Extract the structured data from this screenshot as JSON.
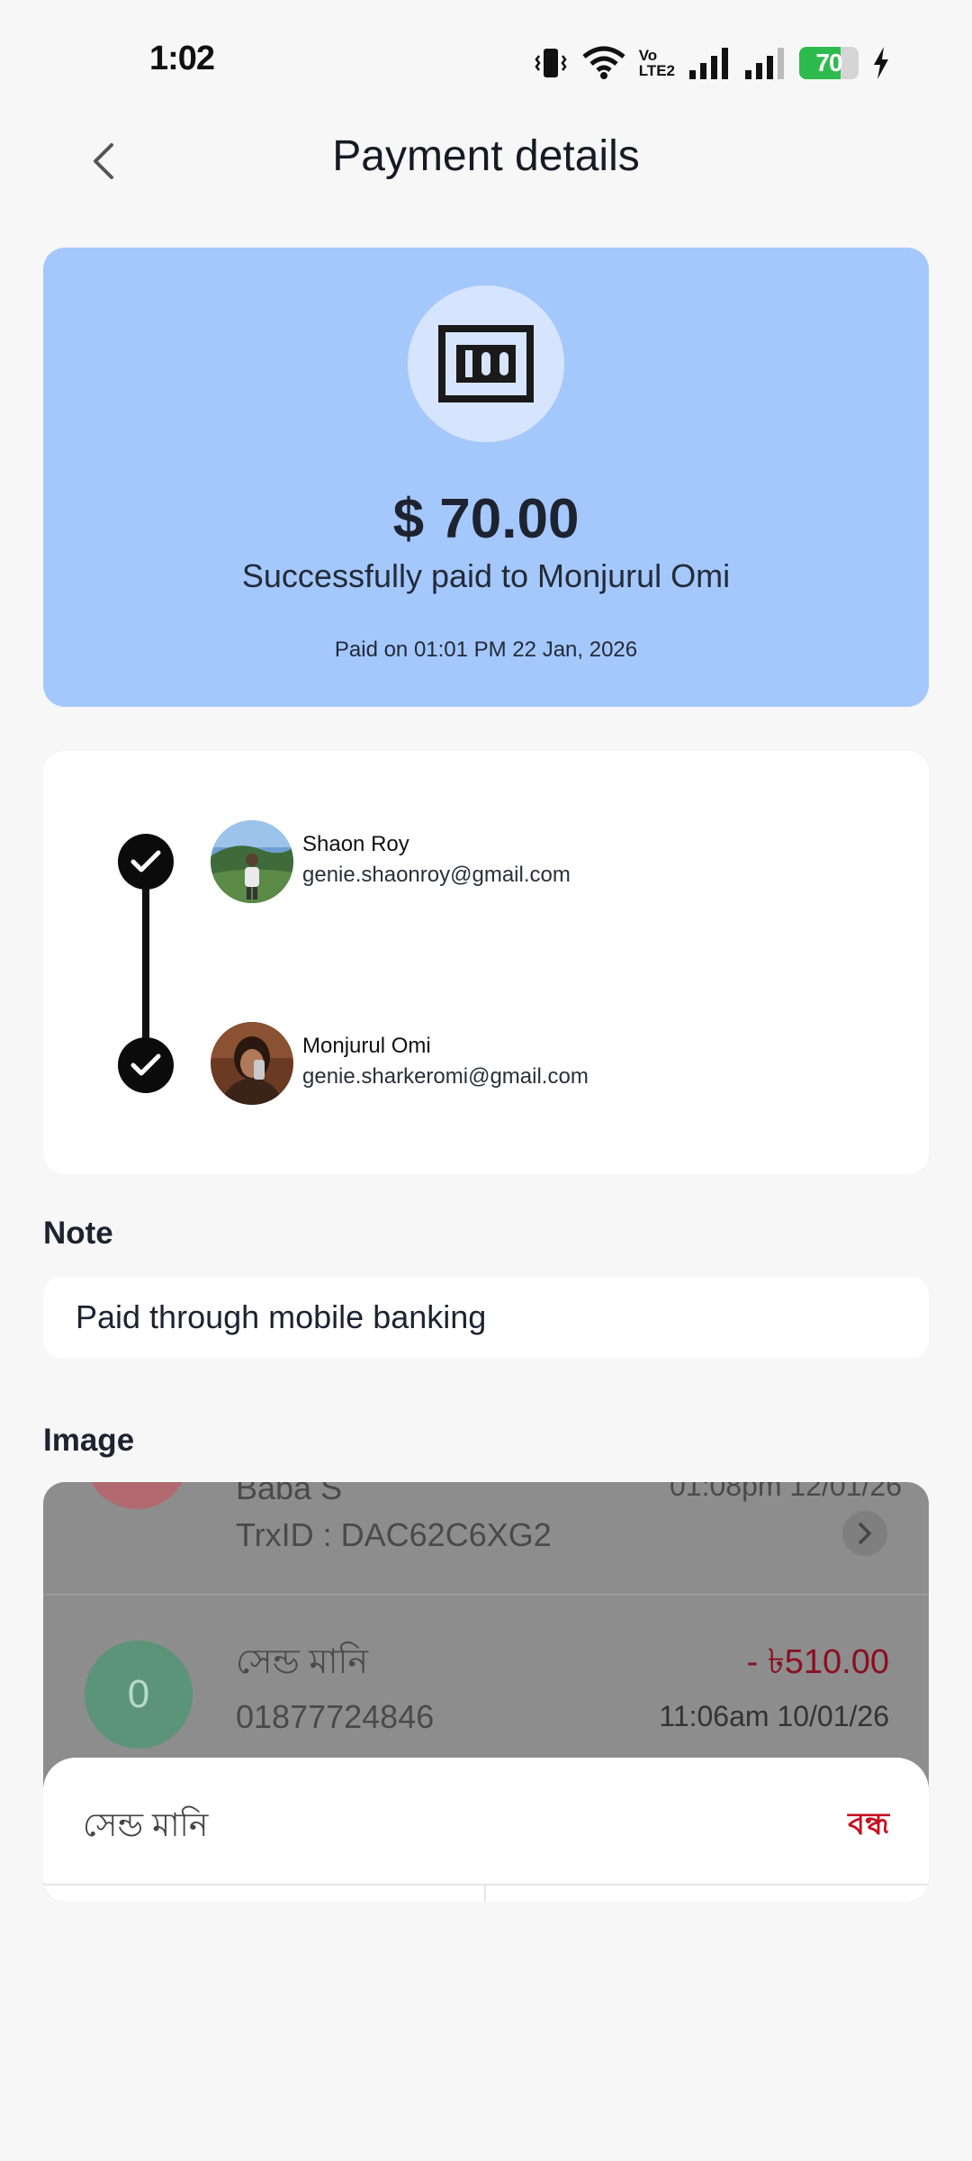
{
  "status_bar": {
    "time": "1:02",
    "volte_top": "Vo",
    "volte_bottom": "LTE2",
    "battery_level": 70,
    "battery_text": "70",
    "icons": [
      "vibrate-icon",
      "wifi-icon",
      "volte-icon",
      "signal-icon",
      "signal-icon",
      "battery-icon",
      "charging-icon"
    ]
  },
  "header": {
    "title": "Payment details"
  },
  "summary": {
    "amount": "$ 70.00",
    "paid_to": "Successfully paid to Monjurul Omi",
    "paid_on": "Paid on 01:01 PM 22 Jan, 2026",
    "icon": "money-100-icon",
    "colors": {
      "card": "#a4c8fc",
      "icon_bg": "#d6e5fd"
    }
  },
  "parties": {
    "sender": {
      "name": "Shaon Roy",
      "email": "genie.shaonroy@gmail.com"
    },
    "recipient": {
      "name": "Monjurul Omi",
      "email": "genie.sharkeromi@gmail.com"
    }
  },
  "note": {
    "label": "Note",
    "text": "Paid through mobile banking"
  },
  "image": {
    "label": "Image",
    "preview": {
      "row1_name_partial": "Baba S",
      "row1_time_partial": "01:08pm 12/01/26",
      "row1_trx": "TrxID : DAC62C6XG2",
      "row2_title": "সেন্ড মানি",
      "row2_number": "01877724846",
      "row2_amount": "- ৳510.00",
      "row2_time": "11:06am 10/01/26",
      "row2_avatar_letter": "0",
      "sheet_title": "সেন্ড মানি",
      "sheet_close": "বন্ধ"
    }
  }
}
